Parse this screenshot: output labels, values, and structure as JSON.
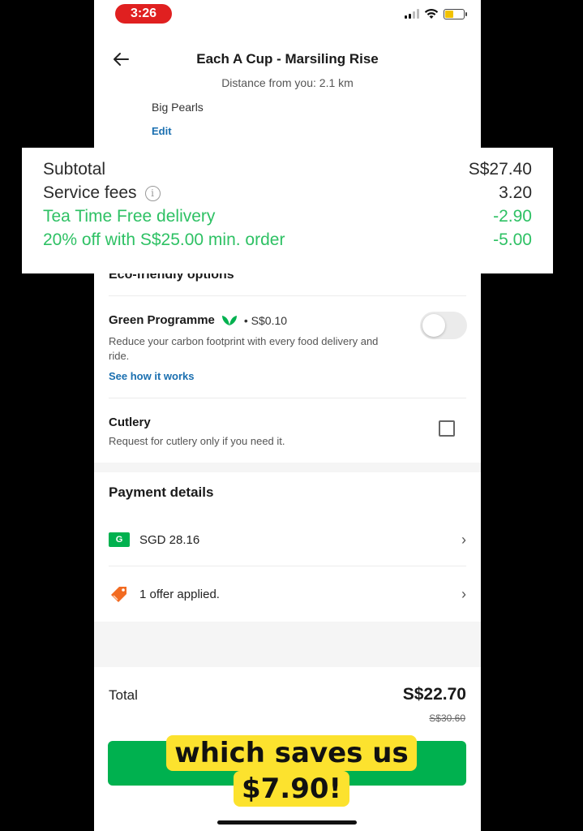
{
  "status_bar": {
    "time": "3:26"
  },
  "header": {
    "title": "Each A Cup - Marsiling Rise",
    "subtitle": "Distance from you: 2.1 km"
  },
  "cart_item": {
    "name": "Big Pearls",
    "edit_label": "Edit"
  },
  "breakdown": {
    "subtotal_label": "Subtotal",
    "subtotal_value": "S$27.40",
    "service_fees_label": "Service fees",
    "service_fees_value": "3.20",
    "delivery_promo_label": "Tea Time Free delivery",
    "delivery_promo_value": "-2.90",
    "discount_label": "20% off with S$25.00 min. order",
    "discount_value": "-5.00"
  },
  "eco": {
    "heading": "Eco-friendly options",
    "green_title": "Green Programme",
    "green_price": "• S$0.10",
    "green_desc": "Reduce your carbon footprint with every food delivery and ride.",
    "see_how_label": "See how it works",
    "green_enabled": false,
    "cutlery_title": "Cutlery",
    "cutlery_desc": "Request for cutlery only if you need it.",
    "cutlery_checked": false
  },
  "payment": {
    "heading": "Payment details",
    "method_icon": "G",
    "method_label": "SGD 28.16",
    "offer_label": "1 offer applied."
  },
  "total": {
    "label": "Total",
    "value": "S$22.70",
    "original_value": "S$30.60"
  },
  "caption": {
    "line1": "which saves us",
    "line2": "$7.90!"
  },
  "colors": {
    "brand_green": "#00b14f",
    "promo_green": "#2ec164",
    "link_blue": "#1a6fb0",
    "caption_yellow": "#fce22e"
  }
}
